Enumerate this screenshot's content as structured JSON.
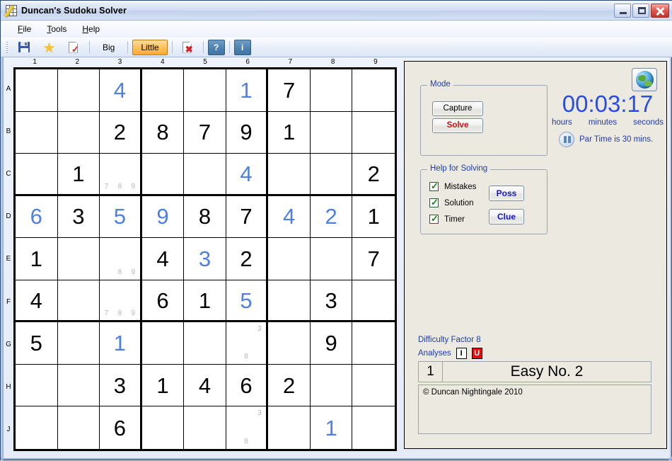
{
  "window": {
    "title": "Duncan's Sudoku Solver",
    "app_icon": "sudoku-pencil-icon",
    "buttons": {
      "minimize": "minimize-icon",
      "maximize": "maximize-icon",
      "close": "close-icon"
    }
  },
  "menubar": {
    "items": [
      {
        "label": "File",
        "accel": "F"
      },
      {
        "label": "Tools",
        "accel": "T"
      },
      {
        "label": "Help",
        "accel": "H"
      }
    ]
  },
  "toolbar": {
    "save_icon": "save-icon",
    "star_icon": "star-icon",
    "new_check_icon": "page-check-icon",
    "big_label": "Big",
    "little_label": "Little",
    "little_active": true,
    "clear_icon": "page-delete-icon",
    "help_label": "?",
    "info_label": "i"
  },
  "board": {
    "column_headers": [
      "1",
      "2",
      "3",
      "4",
      "5",
      "6",
      "7",
      "8",
      "9"
    ],
    "row_headers": [
      "A",
      "B",
      "C",
      "D",
      "E",
      "F",
      "G",
      "H",
      "J"
    ],
    "colors": {
      "given": "#000000",
      "solved": "#4f7fe0",
      "pencil": "#b5b5b5"
    },
    "cells": [
      [
        {},
        {},
        {
          "v": "4",
          "t": "solved"
        },
        {},
        {},
        {
          "v": "1",
          "t": "solved"
        },
        {
          "v": "7",
          "t": "given"
        },
        {},
        {}
      ],
      [
        {},
        {},
        {
          "v": "2",
          "t": "given"
        },
        {
          "v": "8",
          "t": "given"
        },
        {
          "v": "7",
          "t": "given"
        },
        {
          "v": "9",
          "t": "given"
        },
        {
          "v": "1",
          "t": "given"
        },
        {},
        {}
      ],
      [
        {},
        {
          "v": "1",
          "t": "given"
        },
        {
          "p": [
            "",
            "",
            "",
            "",
            "",
            "",
            "7",
            "8",
            "9"
          ]
        },
        {},
        {},
        {
          "v": "4",
          "t": "solved"
        },
        {},
        {},
        {
          "v": "2",
          "t": "given"
        }
      ],
      [
        {
          "v": "6",
          "t": "solved"
        },
        {
          "v": "3",
          "t": "given"
        },
        {
          "v": "5",
          "t": "solved"
        },
        {
          "v": "9",
          "t": "solved"
        },
        {
          "v": "8",
          "t": "given"
        },
        {
          "v": "7",
          "t": "given"
        },
        {
          "v": "4",
          "t": "solved"
        },
        {
          "v": "2",
          "t": "solved"
        },
        {
          "v": "1",
          "t": "given"
        }
      ],
      [
        {
          "v": "1",
          "t": "given"
        },
        {},
        {
          "p": [
            "",
            "",
            "",
            "",
            "",
            "",
            "",
            "8",
            "9"
          ]
        },
        {
          "v": "4",
          "t": "given"
        },
        {
          "v": "3",
          "t": "solved"
        },
        {
          "v": "2",
          "t": "given"
        },
        {},
        {},
        {
          "v": "7",
          "t": "given"
        }
      ],
      [
        {
          "v": "4",
          "t": "given"
        },
        {},
        {
          "p": [
            "",
            "",
            "",
            "",
            "",
            "",
            "7",
            "8",
            "9"
          ]
        },
        {
          "v": "6",
          "t": "given"
        },
        {
          "v": "1",
          "t": "given"
        },
        {
          "v": "5",
          "t": "solved"
        },
        {},
        {
          "v": "3",
          "t": "given"
        },
        {}
      ],
      [
        {
          "v": "5",
          "t": "given"
        },
        {},
        {
          "v": "1",
          "t": "solved"
        },
        {},
        {},
        {
          "p": [
            "",
            "",
            "3",
            "",
            "",
            "",
            "",
            "8",
            ""
          ]
        },
        {},
        {
          "v": "9",
          "t": "given"
        },
        {}
      ],
      [
        {},
        {},
        {
          "v": "3",
          "t": "given"
        },
        {
          "v": "1",
          "t": "given"
        },
        {
          "v": "4",
          "t": "given"
        },
        {
          "v": "6",
          "t": "given"
        },
        {
          "v": "2",
          "t": "given"
        },
        {},
        {}
      ],
      [
        {},
        {},
        {
          "v": "6",
          "t": "given"
        },
        {},
        {},
        {
          "p": [
            "",
            "",
            "3",
            "",
            "",
            "",
            "",
            "8",
            ""
          ]
        },
        {},
        {
          "v": "1",
          "t": "solved"
        },
        {}
      ]
    ]
  },
  "panel": {
    "globe_icon": "globe-icon",
    "mode": {
      "title": "Mode",
      "capture_label": "Capture",
      "solve_label": "Solve"
    },
    "help": {
      "title": "Help for Solving",
      "checkboxes": [
        {
          "label": "Mistakes",
          "checked": true
        },
        {
          "label": "Solution",
          "checked": true
        },
        {
          "label": "Timer",
          "checked": true
        }
      ],
      "poss_label": "Poss",
      "clue_label": "Clue"
    },
    "timer": {
      "value": "00:03:17",
      "unit_hours": "hours",
      "unit_minutes": "minutes",
      "unit_seconds": "seconds",
      "pause_icon": "pause-icon",
      "par_text": "Par Time is 30 mins.",
      "color": "#2a4ce0"
    },
    "status": {
      "difficulty": "Difficulty Factor 8",
      "analyses_label": "Analyses",
      "analysis_i": "I",
      "analysis_u": "U",
      "puzzle_number": "1",
      "puzzle_name": "Easy No. 2",
      "notes": "© Duncan Nightingale 2010"
    }
  }
}
